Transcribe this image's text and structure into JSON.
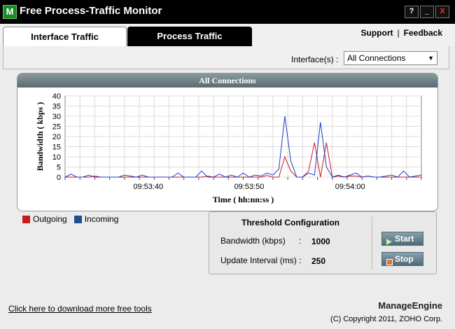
{
  "window": {
    "title": "Free Process-Traffic Monitor",
    "icon_letter": "M",
    "help_btn": "?",
    "min_btn": "_",
    "close_btn": "X"
  },
  "tabs": [
    {
      "label": "Interface Traffic",
      "active": true
    },
    {
      "label": "Process Traffic",
      "active": false
    }
  ],
  "links": {
    "support": "Support",
    "separator": "|",
    "feedback": "Feedback"
  },
  "interface": {
    "label": "Interface(s) :",
    "selected": "All Connections"
  },
  "colors": {
    "outgoing": "#c81a1a",
    "incoming": "#1a3cc8",
    "legend_outgoing": "#c81a1a",
    "legend_incoming": "#1f4e8a"
  },
  "chart_data": {
    "type": "line",
    "title": "All Connections",
    "xlabel": "Time ( hh:nn:ss )",
    "ylabel": "Bandwidth ( kbps )",
    "ylim": [
      0,
      40
    ],
    "yticks": [
      0,
      5,
      10,
      15,
      20,
      25,
      30,
      35,
      40
    ],
    "xlim": [
      0,
      60
    ],
    "xticks": [
      {
        "t": 14,
        "label": "09:53:40"
      },
      {
        "t": 31,
        "label": "09:53:50"
      },
      {
        "t": 48,
        "label": "09:54:00"
      }
    ],
    "grid": true,
    "series": [
      {
        "name": "Outgoing",
        "x": [
          0,
          4,
          5,
          6,
          10,
          20,
          23,
          24,
          25,
          30,
          33,
          34,
          35,
          36,
          37,
          38,
          39,
          40,
          41,
          42,
          43,
          44,
          45,
          46,
          47,
          48,
          49,
          50,
          51,
          52,
          53,
          54,
          60
        ],
        "y": [
          0,
          0,
          0.5,
          0,
          0,
          0,
          0,
          0.5,
          0,
          0,
          0,
          0.8,
          0,
          0,
          10,
          3,
          0,
          0,
          3,
          17,
          0,
          17,
          0,
          0.5,
          0,
          0.5,
          0.5,
          0,
          0.5,
          0,
          0,
          0,
          0
        ]
      },
      {
        "name": "Incoming",
        "x": [
          0,
          1,
          2,
          3,
          4,
          5,
          6,
          7,
          8,
          9,
          10,
          11,
          12,
          13,
          14,
          15,
          16,
          17,
          18,
          19,
          20,
          21,
          22,
          23,
          24,
          25,
          26,
          27,
          28,
          29,
          30,
          31,
          32,
          33,
          34,
          35,
          36,
          37,
          38,
          39,
          40,
          41,
          42,
          43,
          44,
          45,
          46,
          47,
          48,
          49,
          50,
          51,
          52,
          53,
          54,
          55,
          56,
          57,
          58,
          59,
          60
        ],
        "y": [
          0,
          1.5,
          0,
          0,
          1,
          0,
          0,
          0,
          0,
          0,
          1,
          0.5,
          0,
          1,
          0,
          0,
          0,
          0,
          0,
          2,
          0,
          0,
          0,
          3,
          0,
          0,
          1.5,
          0,
          1,
          0,
          2,
          0,
          1,
          0.5,
          2,
          1,
          4,
          30,
          8,
          0,
          0,
          2,
          1,
          27,
          5,
          0,
          1,
          0,
          1,
          2,
          0,
          0.5,
          0,
          0,
          0.5,
          1,
          0,
          3,
          0,
          0.5,
          1
        ]
      }
    ]
  },
  "legend": {
    "outgoing": "Outgoing",
    "incoming": "Incoming"
  },
  "threshold": {
    "title": "Threshold Configuration",
    "bandwidth_label": "Bandwidth (kbps)",
    "bandwidth_value": "1000",
    "interval_label": "Update Interval (ms)",
    "interval_value": "250",
    "colon": ":",
    "start_label": "Start",
    "stop_label": "Stop"
  },
  "footer": {
    "download_link": "Click here to download more free tools",
    "brand": "ManageEngine",
    "copyright": "(C) Copyright 2011, ZOHO Corp."
  }
}
